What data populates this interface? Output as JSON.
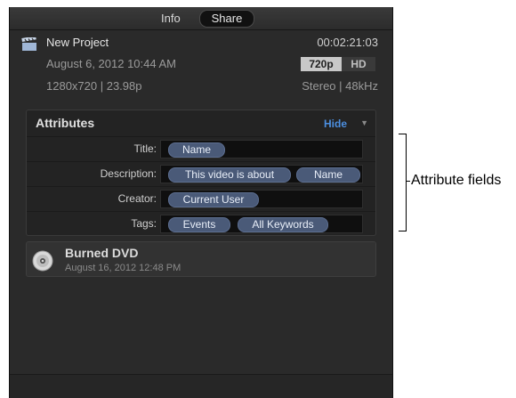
{
  "tabs": {
    "info": "Info",
    "share": "Share"
  },
  "project": {
    "name": "New Project",
    "duration": "00:02:21:03",
    "date": "August 6, 2012 10:44 AM",
    "resolution_badge": "720p",
    "hd_badge": "HD",
    "format": "1280x720  |  23.98p",
    "audio": "Stereo  |  48kHz"
  },
  "attributes": {
    "header": "Attributes",
    "hide_label": "Hide",
    "rows": [
      {
        "label": "Title:",
        "tokens": [
          "Name"
        ]
      },
      {
        "label": "Description:",
        "tokens": [
          "This video is about",
          "Name"
        ]
      },
      {
        "label": "Creator:",
        "tokens": [
          "Current User"
        ]
      },
      {
        "label": "Tags:",
        "tokens": [
          "Events",
          "All Keywords"
        ]
      }
    ]
  },
  "burned": {
    "title": "Burned DVD",
    "date": "August 16, 2012 12:48 PM"
  },
  "callout": {
    "label": "Attribute fields"
  },
  "colors": {
    "accent": "#4c8fe0",
    "token": "#4a5a78",
    "panel": "#2a2a2a"
  }
}
